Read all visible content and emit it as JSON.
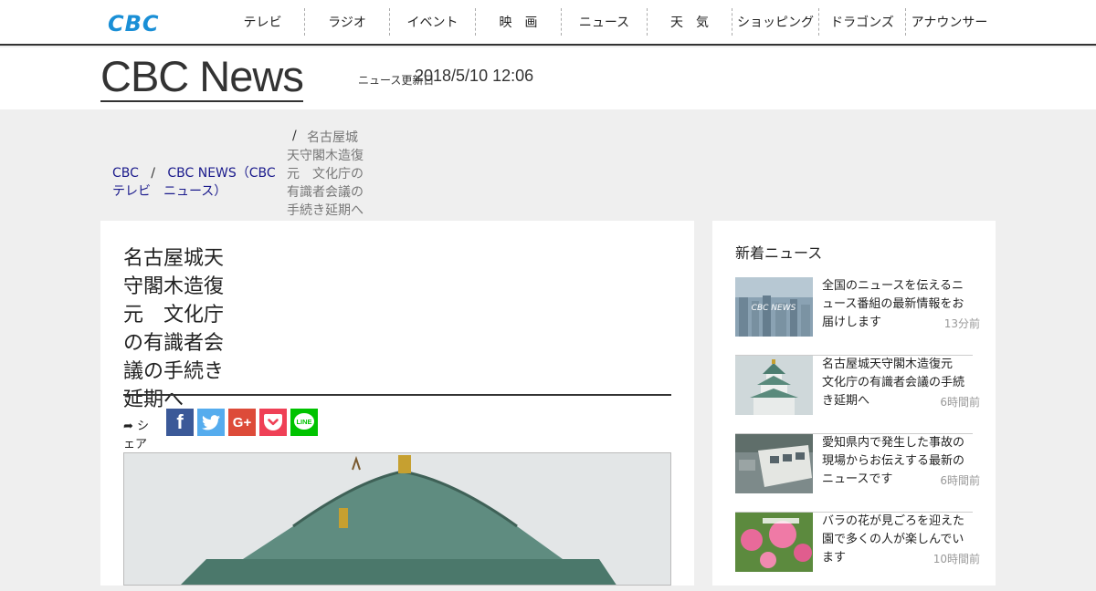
{
  "header": {
    "logo_text": "CBC",
    "nav": [
      {
        "label": "テレビ",
        "width": 92
      },
      {
        "label": "ラジオ",
        "width": 93
      },
      {
        "label": "イベント",
        "width": 94
      },
      {
        "label": "映　画",
        "width": 94
      },
      {
        "label": "ニュース",
        "width": 94
      },
      {
        "label": "天　気",
        "width": 93
      },
      {
        "label": "ショッピング",
        "width": 95
      },
      {
        "label": "ドラゴンズ",
        "width": 95
      },
      {
        "label": "アナウンサー",
        "width": 95
      }
    ]
  },
  "newsbar": {
    "brand": "CBC News",
    "updated_label": "ニュース更新日",
    "updated_time": "2018/5/10 12:06"
  },
  "breadcrumb": {
    "home": "CBC",
    "sep": "/",
    "section": "CBC NEWS（CBCテレビ　ニュース）",
    "current": "名古屋城天守閣木造復元　文化庁の有識者会議の手続き延期へ"
  },
  "article": {
    "headline": "名古屋城天守閣木造復元　文化庁の有識者会議の手続き延期へ",
    "share_label": "シェアする"
  },
  "sidebar": {
    "title": "新着ニュース",
    "items": [
      {
        "title": "全国のニュースを伝えるニュース番組の最新情報をお届けします",
        "time": "13分前"
      },
      {
        "title": "名古屋城天守閣木造復元　文化庁の有識者会議の手続き延期へ",
        "time": "6時間前"
      },
      {
        "title": "愛知県内で発生した事故の現場からお伝えする最新のニュースです",
        "time": "6時間前"
      },
      {
        "title": "バラの花が見ごろを迎えた園で多くの人が楽しんでいます",
        "time": "10時間前"
      }
    ]
  },
  "colors": {
    "logo": "#1a8fd6",
    "link": "#1a1a8c",
    "facebook": "#3b5998",
    "twitter": "#55acee",
    "googleplus": "#dd4b39",
    "pocket": "#ef4056",
    "line": "#00c300"
  }
}
